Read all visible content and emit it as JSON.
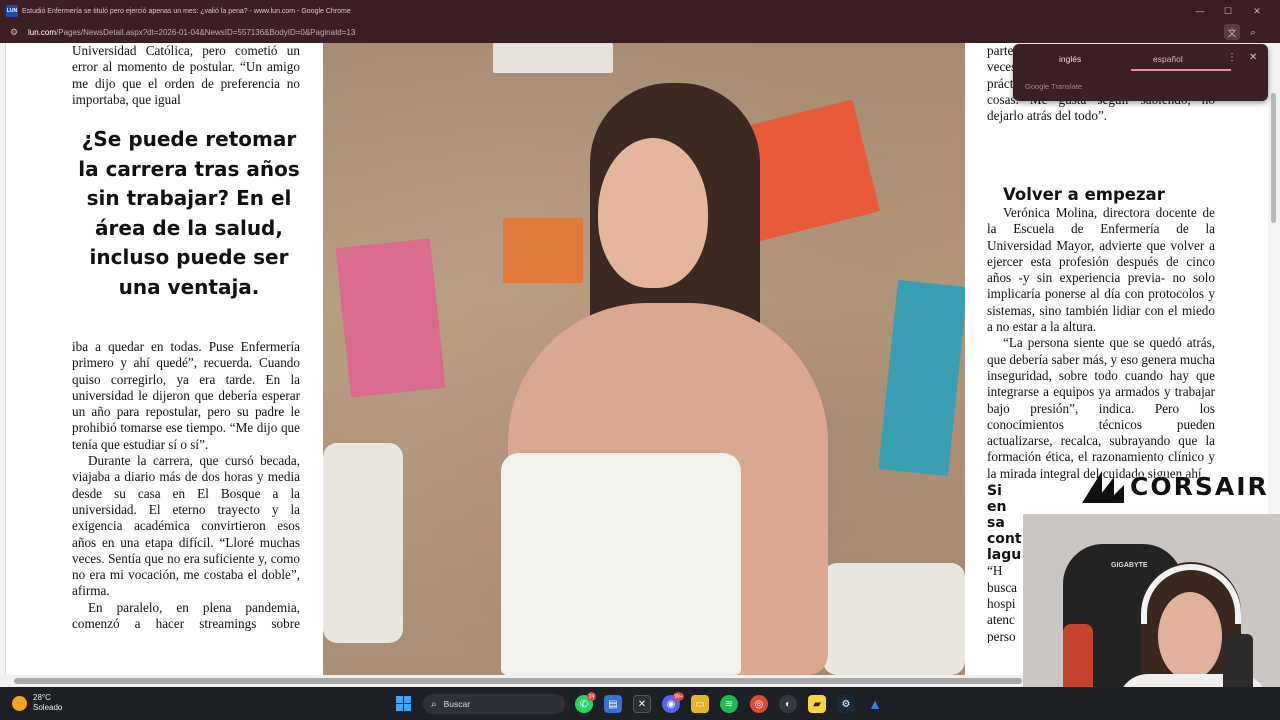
{
  "window": {
    "favicon_text": "LUN",
    "title": "Estudió Enfermería se tituló pero ejerció apenas un mes: ¿valió la pena? - www.lun.com - Google Chrome"
  },
  "address_bar": {
    "url_host": "lun.com",
    "url_path": "/Pages/NewsDetail.aspx?dt=2026-01-04&NewsID=557136&BodyID=0&PaginaId=13"
  },
  "translate_popup": {
    "tab_source": "inglés",
    "tab_target": "español",
    "brand": "Google Translate",
    "menu_icon": "more-vert-icon",
    "close_icon": "close-icon"
  },
  "article": {
    "left_top": "Universidad Católica, pero cometió un error al momento de postular. “Un amigo me dijo que el orden de preferencia no importaba, que igual",
    "pull_quote": "¿Se puede retomar la carrera tras años sin trabajar? En el área de la salud, incluso puede ser una ventaja.",
    "left_p1": "iba a quedar en todas. Puse Enfermería primero y ahí quedé”, recuerda. Cuando quiso corregirlo, ya era tarde. En la universidad le dijeron que debería esperar un año para repostular, pero su padre le prohibió tomarse ese tiempo. “Me dijo que tenía que estudiar sí o sí”.",
    "left_p2": "Durante la carrera, que cursó becada, viajaba a diario más de dos horas y media desde su casa en El Bosque a la universidad. El eterno trayecto y la exigencia académica convirtieron esos años en una etapa difícil. “Lloré muchas veces. Sentía que no era suficiente y, como no era mi vocación, me costaba el doble”, afirma.",
    "left_p3": "En paralelo, en plena pandemia, comenzó a hacer streamings sobre videojuegos: al principio era una",
    "right_top": "parte que sola más adelante, yo feliz. A veces hago cosas gratis para no perder la práctica: pongo sueros, inyecciones, esas cosas. Me gusta seguir sabiendo, no dejarlo atrás del todo”.",
    "right_heading": "Volver a empezar",
    "right_p1": "Verónica Molina, directora docente de la Escuela de Enfermería de la Universidad Mayor, advierte que volver a ejercer esta profesión después de cinco años -y sin experiencia previa- no solo implicaría ponerse al día con protocolos y sistemas, sino también lidiar con el miedo a no estar a la altura.",
    "right_p2": "“La persona siente que se quedó atrás, que debería saber más, y eso genera mucha inseguridad, sobre todo cuando hay que integrarse a equipos ya armados y trabajar bajo presión”, indica. Pero los conocimientos técnicos pueden actualizarse, recalca, subrayando que la formación ética, el razonamiento clínico y la mirada integral del cuidado siguen ahí.",
    "right_subhead": "Si en sa cont lagu",
    "right_p3": "“H busca hospi atenc perso entre"
  },
  "taskbar": {
    "temperature": "28°C",
    "weather": "Soleado",
    "search_label": "Buscar",
    "badge_whatsapp": "24",
    "badge_discord": "99+"
  },
  "stream_overlay": {
    "sponsor": "CORSAIR",
    "chair_brand": "GIGABYTE"
  }
}
